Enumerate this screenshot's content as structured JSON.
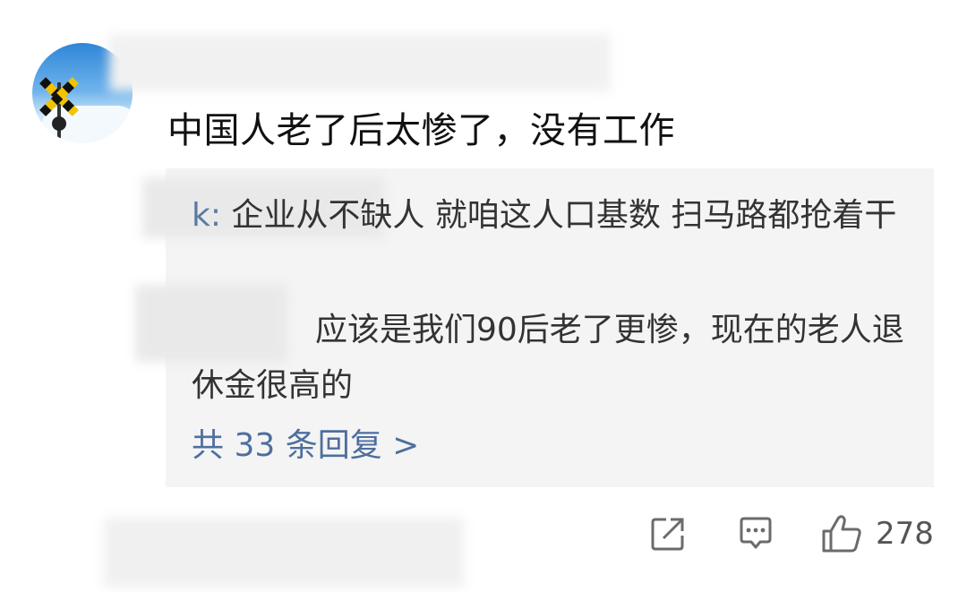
{
  "comment": {
    "text": "中国人老了后太惨了，没有工作"
  },
  "replies": [
    {
      "author_suffix": "k:",
      "text": " 企业从不缺人 就咱这人口基数 扫马路都抢着干"
    },
    {
      "text": "应该是我们90后老了更惨，现在的老人退休金很高的"
    }
  ],
  "more_replies_label": "共 33 条回复 >",
  "actions": {
    "share_icon": "share-icon",
    "reply_icon": "comment-icon",
    "like_icon": "thumbs-up-icon",
    "like_count": "278"
  }
}
